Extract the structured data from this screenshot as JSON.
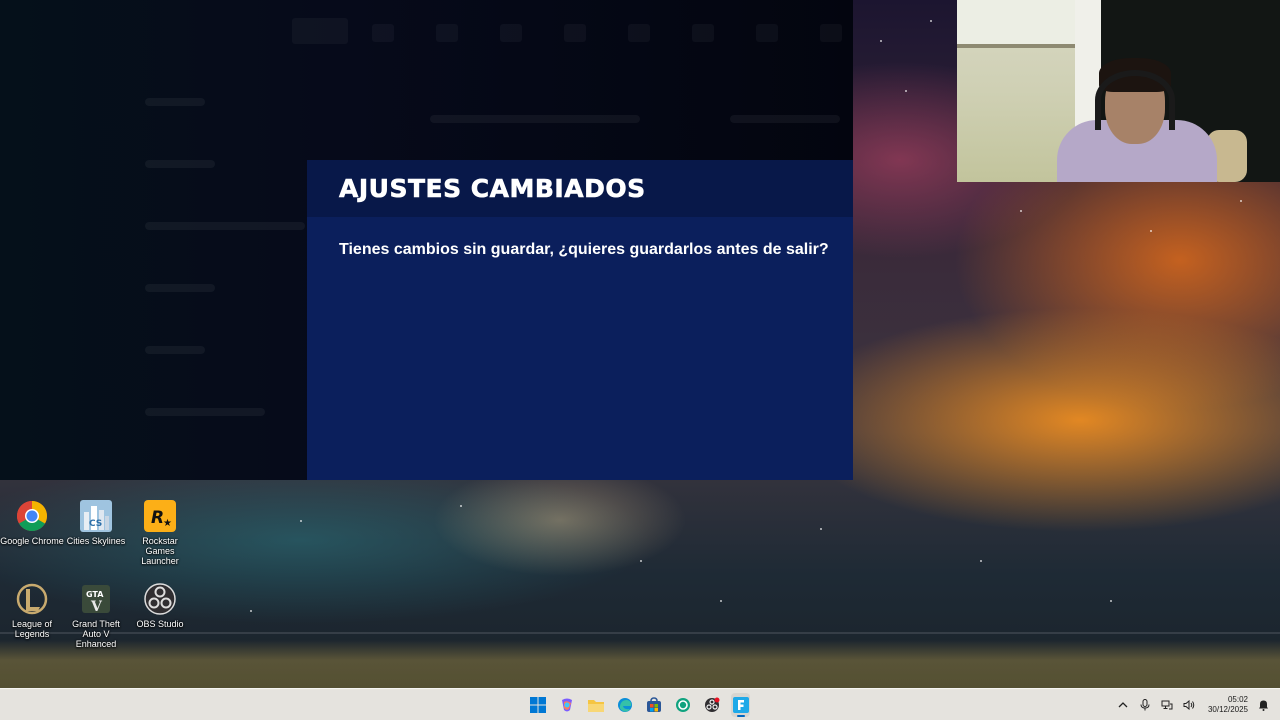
{
  "dialog": {
    "title": "AJUSTES CAMBIADOS",
    "message": "Tienes cambios sin guardar, ¿quieres guardarlos antes de salir?"
  },
  "desktop": {
    "icons": [
      {
        "label": "Google Chrome",
        "icon": "chrome-icon"
      },
      {
        "label": "Cities Skylines",
        "icon": "cities-skylines-icon"
      },
      {
        "label": "Rockstar Games Launcher",
        "icon": "rockstar-icon"
      },
      {
        "label": "League of Legends",
        "icon": "league-of-legends-icon"
      },
      {
        "label": "Grand Theft Auto V Enhanced",
        "icon": "gta-v-icon"
      },
      {
        "label": "OBS Studio",
        "icon": "obs-icon"
      }
    ]
  },
  "taskbar": {
    "apps": [
      "start-icon",
      "copilot-icon",
      "file-explorer-icon",
      "edge-icon",
      "store-icon",
      "chatgpt-icon",
      "obs-icon",
      "fortnite-icon"
    ],
    "clock": {
      "time": "05:02",
      "date": "30/12/2025"
    }
  },
  "colors": {
    "dialog_bg": "#0b1f5c",
    "dialog_header": "#081849",
    "accent": "#0067c0"
  }
}
